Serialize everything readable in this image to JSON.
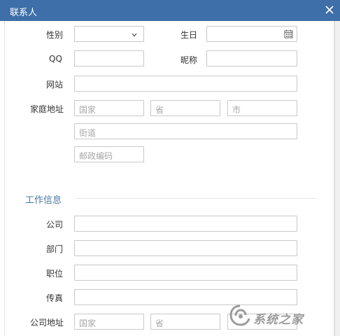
{
  "window": {
    "title": "联系人"
  },
  "form": {
    "gender_label": "性别",
    "gender_value": "",
    "birthday_label": "生日",
    "birthday_value": "",
    "qq_label": "QQ",
    "qq_value": "",
    "nickname_label": "昵称",
    "nickname_value": "",
    "website_label": "网站",
    "website_value": "",
    "home_address_label": "家庭地址",
    "home_country_placeholder": "国家",
    "home_province_placeholder": "省",
    "home_city_placeholder": "市",
    "home_street_placeholder": "街道",
    "home_zip_placeholder": "邮政编码"
  },
  "work": {
    "section_title": "工作信息",
    "company_label": "公司",
    "company_value": "",
    "department_label": "部门",
    "department_value": "",
    "position_label": "职位",
    "position_value": "",
    "fax_label": "传真",
    "fax_value": "",
    "company_address_label": "公司地址",
    "work_country_placeholder": "国家",
    "work_province_placeholder": "省"
  },
  "watermark": {
    "text": "系统之家"
  }
}
